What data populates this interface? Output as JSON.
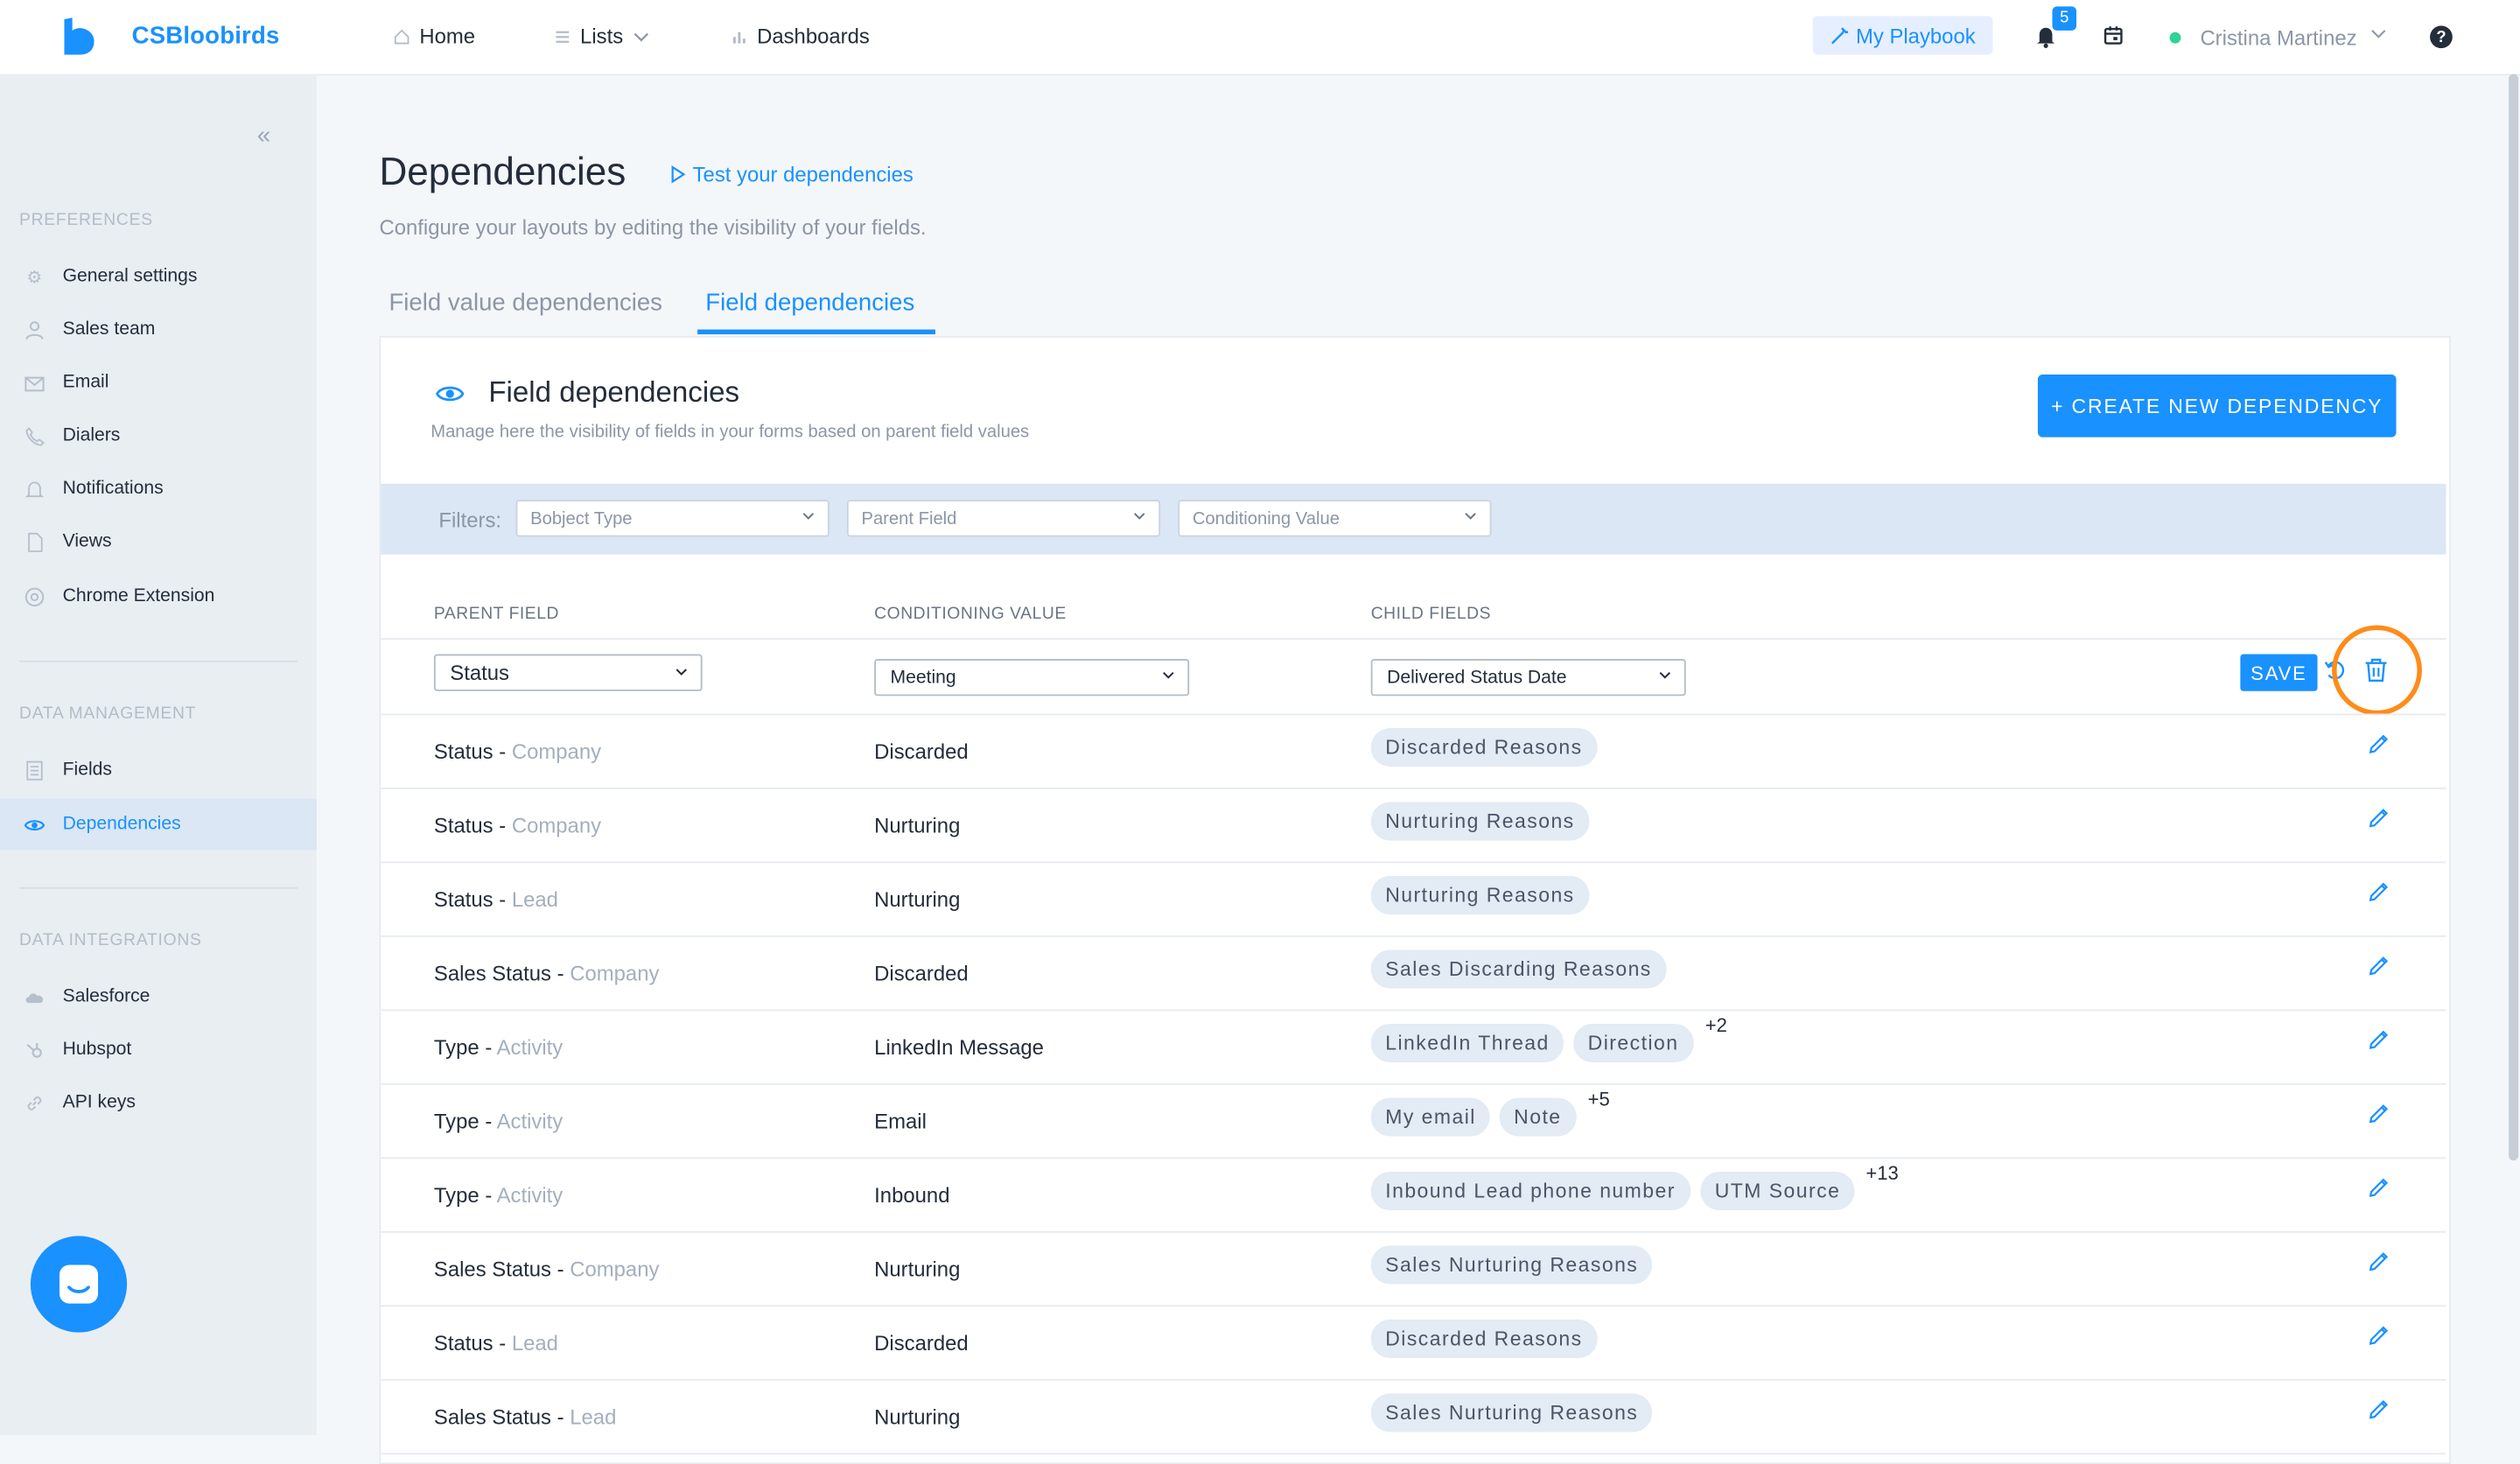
{
  "app": {
    "brand": "CSBloobirds"
  },
  "topnav": {
    "home": "Home",
    "lists": "Lists",
    "dashboards": "Dashboards",
    "playbook": "My Playbook",
    "notifications_count": "5",
    "user_name": "Cristina Martinez",
    "help": "?"
  },
  "sidebar": {
    "collapse": "«",
    "sections": {
      "preferences": "PREFERENCES",
      "data_management": "DATA MANAGEMENT",
      "data_integrations": "DATA INTEGRATIONS"
    },
    "items": [
      {
        "label": "General settings",
        "icon": "gear-icon"
      },
      {
        "label": "Sales team",
        "icon": "person-icon"
      },
      {
        "label": "Email",
        "icon": "mail-icon"
      },
      {
        "label": "Dialers",
        "icon": "phone-icon"
      },
      {
        "label": "Notifications",
        "icon": "bell-icon"
      },
      {
        "label": "Views",
        "icon": "file-icon"
      },
      {
        "label": "Chrome Extension",
        "icon": "chrome-icon"
      },
      {
        "label": "Fields",
        "icon": "list-icon"
      },
      {
        "label": "Dependencies",
        "icon": "eye-icon",
        "active": true
      },
      {
        "label": "Salesforce",
        "icon": "cloud-icon"
      },
      {
        "label": "Hubspot",
        "icon": "hubspot-icon"
      },
      {
        "label": "API keys",
        "icon": "link-icon"
      }
    ]
  },
  "page": {
    "title": "Dependencies",
    "test_link": "Test your dependencies",
    "subtitle": "Configure your layouts by editing the visibility of your fields.",
    "tabs": [
      "Field value dependencies",
      "Field dependencies"
    ],
    "active_tab": 1
  },
  "card": {
    "title": "Field dependencies",
    "subtitle": "Manage here the visibility of fields in your forms based on parent field values",
    "create_button": "+  CREATE NEW DEPENDENCY",
    "filters_label": "Filters:",
    "filters": [
      "Bobject Type",
      "Parent Field",
      "Conditioning Value"
    ],
    "columns": [
      "PARENT FIELD",
      "CONDITIONING VALUE",
      "CHILD FIELDS"
    ],
    "edit_row": {
      "parent": "Status",
      "conditioning": "Meeting",
      "child": "Delivered Status Date",
      "save": "SAVE"
    },
    "rows": [
      {
        "field": "Status",
        "object": "Company",
        "value": "Discarded",
        "chips": [
          "Discarded Reasons"
        ],
        "more": ""
      },
      {
        "field": "Status",
        "object": "Company",
        "value": "Nurturing",
        "chips": [
          "Nurturing Reasons"
        ],
        "more": ""
      },
      {
        "field": "Status",
        "object": "Lead",
        "value": "Nurturing",
        "chips": [
          "Nurturing Reasons"
        ],
        "more": ""
      },
      {
        "field": "Sales Status",
        "object": "Company",
        "value": "Discarded",
        "chips": [
          "Sales Discarding Reasons"
        ],
        "more": ""
      },
      {
        "field": "Type",
        "object": "Activity",
        "value": "LinkedIn Message",
        "chips": [
          "LinkedIn Thread",
          "Direction"
        ],
        "more": "+2"
      },
      {
        "field": "Type",
        "object": "Activity",
        "value": "Email",
        "chips": [
          "My email",
          "Note"
        ],
        "more": "+5"
      },
      {
        "field": "Type",
        "object": "Activity",
        "value": "Inbound",
        "chips": [
          "Inbound Lead phone number",
          "UTM Source"
        ],
        "more": "+13"
      },
      {
        "field": "Sales Status",
        "object": "Company",
        "value": "Nurturing",
        "chips": [
          "Sales Nurturing Reasons"
        ],
        "more": ""
      },
      {
        "field": "Status",
        "object": "Lead",
        "value": "Discarded",
        "chips": [
          "Discarded Reasons"
        ],
        "more": ""
      },
      {
        "field": "Sales Status",
        "object": "Lead",
        "value": "Nurturing",
        "chips": [
          "Sales Nurturing Reasons"
        ],
        "more": ""
      }
    ]
  }
}
